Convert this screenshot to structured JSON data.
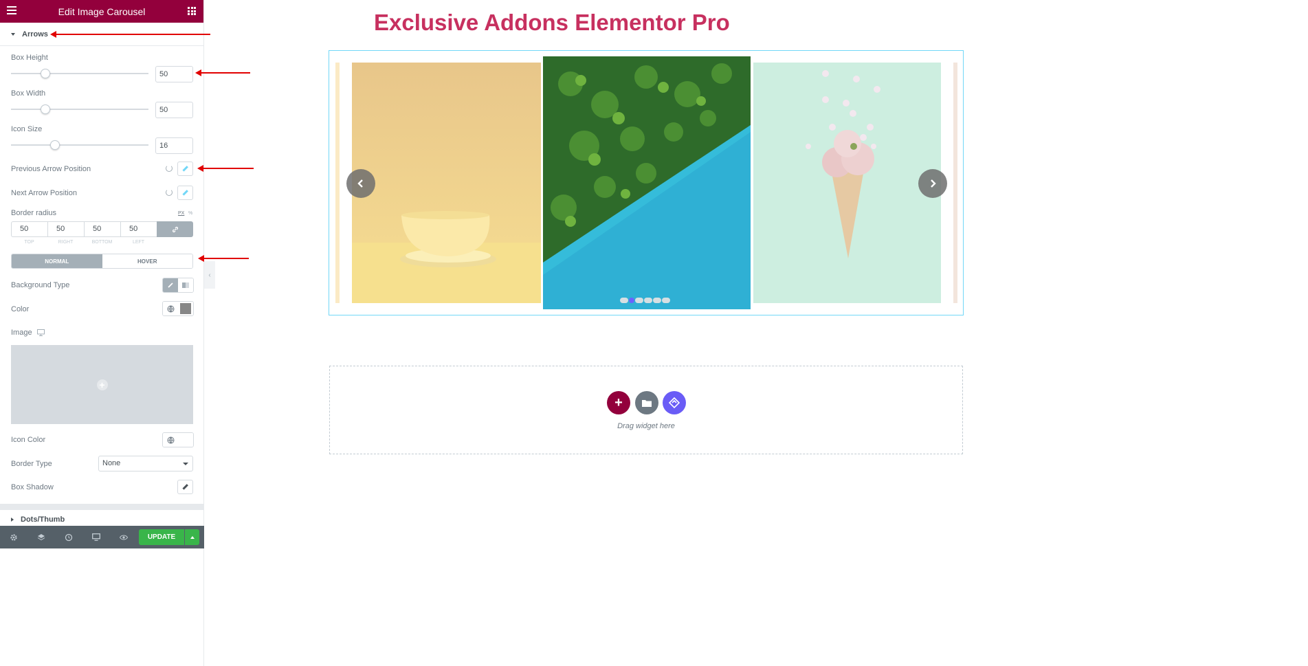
{
  "panel": {
    "title": "Edit Image Carousel",
    "sections": {
      "arrows": "Arrows",
      "dots": "Dots/Thumb"
    },
    "controls": {
      "box_height": {
        "label": "Box Height",
        "value": "50",
        "fraction": 0.25
      },
      "box_width": {
        "label": "Box Width",
        "value": "50",
        "fraction": 0.25
      },
      "icon_size": {
        "label": "Icon Size",
        "value": "16",
        "fraction": 0.32
      },
      "prev_arrow": "Previous Arrow Position",
      "next_arrow": "Next Arrow Position",
      "border_radius": {
        "label": "Border radius",
        "units": [
          "PX",
          "%"
        ],
        "values": [
          "50",
          "50",
          "50",
          "50"
        ],
        "sides": [
          "TOP",
          "RIGHT",
          "BOTTOM",
          "LEFT"
        ]
      },
      "tabs": [
        "NORMAL",
        "HOVER"
      ],
      "background_type": "Background Type",
      "color": "Color",
      "color_value": "#878787",
      "image": "Image",
      "icon_color": "Icon Color",
      "border_type": {
        "label": "Border Type",
        "value": "None"
      },
      "box_shadow": "Box Shadow"
    },
    "footer": {
      "update": "UPDATE"
    },
    "accent": "#93003c"
  },
  "preview": {
    "title": "Exclusive Addons Elementor Pro",
    "carousel": {
      "dots_total": 6,
      "dot_active": 2
    },
    "dropzone": {
      "text": "Drag widget here"
    }
  }
}
